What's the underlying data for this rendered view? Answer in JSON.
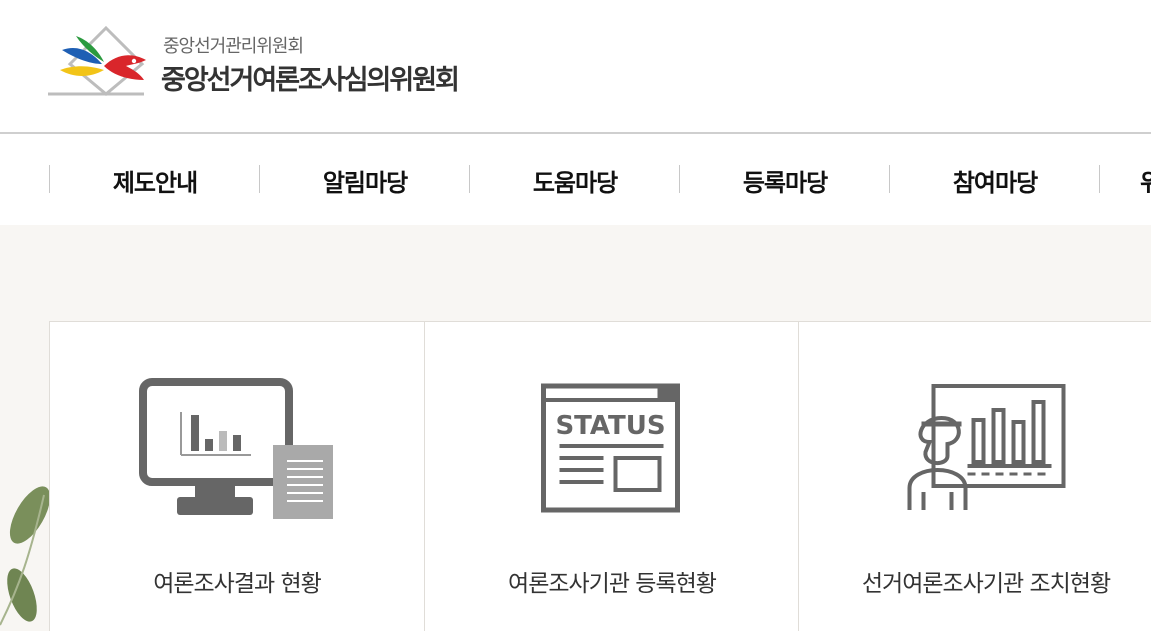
{
  "header": {
    "org_small": "중앙선거관리위원회",
    "org_large": "중앙선거여론조사심의위원회"
  },
  "nav": {
    "items": [
      {
        "label": "제도안내"
      },
      {
        "label": "알림마당"
      },
      {
        "label": "도움마당"
      },
      {
        "label": "등록마당"
      },
      {
        "label": "참여마당"
      },
      {
        "label": "위"
      }
    ]
  },
  "cards": [
    {
      "label": "여론조사결과 현황",
      "icon": "monitor-chart-icon"
    },
    {
      "label": "여론조사기관 등록현황",
      "icon": "status-document-icon",
      "icon_text": "STATUS"
    },
    {
      "label": "선거여론조사기관 조치현황",
      "icon": "presenter-chart-icon"
    }
  ],
  "colors": {
    "icon_gray": "#666666",
    "background": "#f8f6f3",
    "border": "#e0ddd8"
  }
}
